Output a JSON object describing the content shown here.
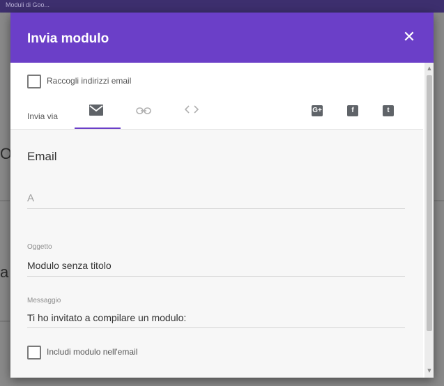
{
  "background": {
    "header_text": "Moduli di Goo..."
  },
  "dialog": {
    "title": "Invia modulo",
    "close_icon": "close-icon",
    "collect_emails_label": "Raccogli indirizzi email",
    "send_via_label": "Invia via",
    "tabs": [
      {
        "name": "email",
        "icon": "envelope-icon",
        "selected": true
      },
      {
        "name": "link",
        "icon": "link-icon",
        "selected": false
      },
      {
        "name": "embed",
        "icon": "code-icon",
        "selected": false
      }
    ],
    "social": [
      {
        "name": "google-plus",
        "glyph": "G+"
      },
      {
        "name": "facebook",
        "glyph": "f"
      },
      {
        "name": "twitter",
        "glyph": "t"
      }
    ],
    "section_title": "Email",
    "to_placeholder": "A",
    "subject_label": "Oggetto",
    "subject_value": "Modulo senza titolo",
    "message_label": "Messaggio",
    "message_value": "Ti ho invitato a compilare un modulo:",
    "include_form_label": "Includi modulo nell'email"
  },
  "colors": {
    "accent": "#6b3fc8",
    "header_bg": "#6b3fc8"
  }
}
